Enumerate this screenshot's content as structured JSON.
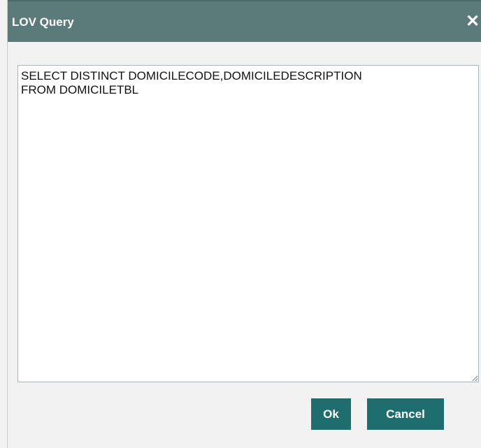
{
  "dialog": {
    "title": "LOV Query",
    "close_glyph": "✕",
    "close_icon": "close-icon",
    "query_text": "SELECT DISTINCT DOMICILECODE,DOMICILEDESCRIPTION\nFROM DOMICILETBL",
    "ok_label": "Ok",
    "cancel_label": "Cancel"
  },
  "colors": {
    "titlebar": "#5b7b7b",
    "button": "#1f6e6e",
    "background": "#f2f2f2"
  }
}
